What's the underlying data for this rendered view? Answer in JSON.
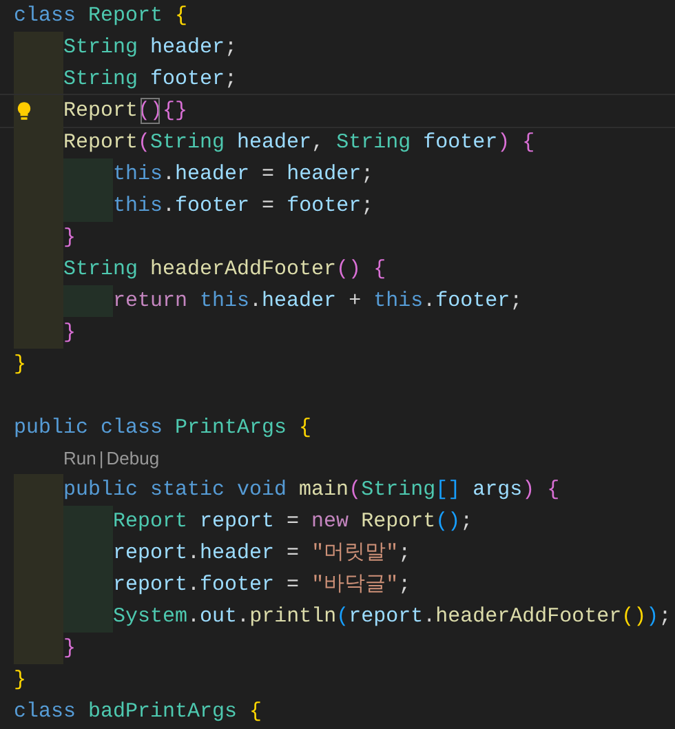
{
  "editor": {
    "lines": [
      {
        "kind": "code",
        "current": false,
        "tokens": [
          {
            "kind": "keyword",
            "text": "class"
          },
          {
            "kind": "type",
            "text": " Report"
          },
          {
            "kind": "bracket1",
            "text": " {"
          }
        ],
        "children": [
          {
            "kind": "code",
            "current": false,
            "tokens": [
              {
                "kind": "type",
                "text": "String"
              },
              {
                "kind": "variable",
                "text": " header"
              },
              {
                "kind": "plain",
                "text": ";"
              }
            ]
          },
          {
            "kind": "code",
            "current": false,
            "tokens": [
              {
                "kind": "type",
                "text": "String"
              },
              {
                "kind": "variable",
                "text": " footer"
              },
              {
                "kind": "plain",
                "text": ";"
              }
            ]
          },
          {
            "kind": "code",
            "current": true,
            "tokens": [
              {
                "kind": "function",
                "text": "Report"
              },
              {
                "kind": "match",
                "text": "()"
              },
              {
                "kind": "bracket2",
                "text": "{}"
              }
            ]
          },
          {
            "kind": "code",
            "current": false,
            "tokens": [
              {
                "kind": "function",
                "text": "Report"
              },
              {
                "kind": "bracket2",
                "text": "("
              },
              {
                "kind": "type",
                "text": "String"
              },
              {
                "kind": "variable",
                "text": " header"
              },
              {
                "kind": "plain",
                "text": ","
              },
              {
                "kind": "type",
                "text": " String"
              },
              {
                "kind": "variable",
                "text": " footer"
              },
              {
                "kind": "bracket2",
                "text": ")"
              },
              {
                "kind": "bracket2",
                "text": " {"
              }
            ],
            "children": [
              {
                "kind": "code",
                "current": false,
                "tokens": [
                  {
                    "kind": "keyword",
                    "text": "this"
                  },
                  {
                    "kind": "plain",
                    "text": "."
                  },
                  {
                    "kind": "variable",
                    "text": "header"
                  },
                  {
                    "kind": "plain",
                    "text": " ="
                  },
                  {
                    "kind": "variable",
                    "text": " header"
                  },
                  {
                    "kind": "plain",
                    "text": ";"
                  }
                ]
              },
              {
                "kind": "code",
                "current": false,
                "tokens": [
                  {
                    "kind": "keyword",
                    "text": "this"
                  },
                  {
                    "kind": "plain",
                    "text": "."
                  },
                  {
                    "kind": "variable",
                    "text": "footer"
                  },
                  {
                    "kind": "plain",
                    "text": " ="
                  },
                  {
                    "kind": "variable",
                    "text": " footer"
                  },
                  {
                    "kind": "plain",
                    "text": ";"
                  }
                ]
              }
            ]
          },
          {
            "kind": "code",
            "current": false,
            "tokens": [
              {
                "kind": "bracket2",
                "text": "}"
              }
            ]
          },
          {
            "kind": "code",
            "current": false,
            "tokens": [
              {
                "kind": "type",
                "text": "String"
              },
              {
                "kind": "function",
                "text": " headerAddFooter"
              },
              {
                "kind": "bracket2",
                "text": "()"
              },
              {
                "kind": "bracket2",
                "text": " {"
              }
            ],
            "children": [
              {
                "kind": "code",
                "current": false,
                "tokens": [
                  {
                    "kind": "control",
                    "text": "return"
                  },
                  {
                    "kind": "keyword",
                    "text": " this"
                  },
                  {
                    "kind": "plain",
                    "text": "."
                  },
                  {
                    "kind": "variable",
                    "text": "header"
                  },
                  {
                    "kind": "plain",
                    "text": " +"
                  },
                  {
                    "kind": "keyword",
                    "text": " this"
                  },
                  {
                    "kind": "plain",
                    "text": "."
                  },
                  {
                    "kind": "variable",
                    "text": "footer"
                  },
                  {
                    "kind": "plain",
                    "text": ";"
                  }
                ]
              }
            ]
          },
          {
            "kind": "code",
            "current": false,
            "tokens": [
              {
                "kind": "bracket2",
                "text": "}"
              }
            ]
          }
        ]
      },
      {
        "kind": "code",
        "current": false,
        "tokens": [
          {
            "kind": "bracket1",
            "text": "}"
          }
        ]
      },
      {
        "kind": "code",
        "current": false
      },
      {
        "kind": "code",
        "current": false,
        "tokens": [
          {
            "kind": "keyword",
            "text": "public"
          },
          {
            "kind": "keyword",
            "text": " class"
          },
          {
            "kind": "type",
            "text": " PrintArgs"
          },
          {
            "kind": "bracket1",
            "text": " {"
          }
        ],
        "children": [
          {
            "kind": "codelens",
            "current": false,
            "tokens": [
              {
                "kind": "link",
                "text": "Run"
              },
              {
                "kind": "separator",
                "text": "|"
              },
              {
                "kind": "link",
                "text": "Debug"
              }
            ]
          },
          {
            "kind": "code",
            "current": false,
            "tokens": [
              {
                "kind": "keyword",
                "text": "public"
              },
              {
                "kind": "keyword",
                "text": " static"
              },
              {
                "kind": "keyword",
                "text": " void"
              },
              {
                "kind": "function",
                "text": " main"
              },
              {
                "kind": "bracket2",
                "text": "("
              },
              {
                "kind": "type",
                "text": "String"
              },
              {
                "kind": "bracket3",
                "text": "[]"
              },
              {
                "kind": "variable",
                "text": " args"
              },
              {
                "kind": "bracket2",
                "text": ")"
              },
              {
                "kind": "bracket2",
                "text": " {"
              }
            ],
            "children": [
              {
                "kind": "code",
                "current": false,
                "tokens": [
                  {
                    "kind": "type",
                    "text": "Report"
                  },
                  {
                    "kind": "variable",
                    "text": " report"
                  },
                  {
                    "kind": "plain",
                    "text": " ="
                  },
                  {
                    "kind": "control",
                    "text": " new"
                  },
                  {
                    "kind": "function",
                    "text": " Report"
                  },
                  {
                    "kind": "bracket3",
                    "text": "()"
                  },
                  {
                    "kind": "plain",
                    "text": ";"
                  }
                ]
              },
              {
                "kind": "code",
                "current": false,
                "tokens": [
                  {
                    "kind": "variable",
                    "text": "report"
                  },
                  {
                    "kind": "plain",
                    "text": "."
                  },
                  {
                    "kind": "variable",
                    "text": "header"
                  },
                  {
                    "kind": "plain",
                    "text": " ="
                  },
                  {
                    "kind": "string",
                    "text": " \"머릿말\""
                  },
                  {
                    "kind": "plain",
                    "text": ";"
                  }
                ]
              },
              {
                "kind": "code",
                "current": false,
                "tokens": [
                  {
                    "kind": "variable",
                    "text": "report"
                  },
                  {
                    "kind": "plain",
                    "text": "."
                  },
                  {
                    "kind": "variable",
                    "text": "footer"
                  },
                  {
                    "kind": "plain",
                    "text": " ="
                  },
                  {
                    "kind": "string",
                    "text": " \"바닥글\""
                  },
                  {
                    "kind": "plain",
                    "text": ";"
                  }
                ]
              },
              {
                "kind": "code",
                "current": false,
                "tokens": [
                  {
                    "kind": "type",
                    "text": "System"
                  },
                  {
                    "kind": "plain",
                    "text": "."
                  },
                  {
                    "kind": "variable",
                    "text": "out"
                  },
                  {
                    "kind": "plain",
                    "text": "."
                  },
                  {
                    "kind": "function",
                    "text": "println"
                  },
                  {
                    "kind": "bracket3",
                    "text": "("
                  },
                  {
                    "kind": "variable",
                    "text": "report"
                  },
                  {
                    "kind": "plain",
                    "text": "."
                  },
                  {
                    "kind": "function",
                    "text": "headerAddFooter"
                  },
                  {
                    "kind": "bracket1",
                    "text": "()"
                  },
                  {
                    "kind": "bracket3",
                    "text": ")"
                  },
                  {
                    "kind": "plain",
                    "text": ";"
                  }
                ]
              }
            ]
          },
          {
            "kind": "code",
            "current": false,
            "tokens": [
              {
                "kind": "bracket2",
                "text": "}"
              }
            ]
          }
        ]
      },
      {
        "kind": "code",
        "current": false,
        "tokens": [
          {
            "kind": "bracket1",
            "text": "}"
          }
        ]
      },
      {
        "kind": "code",
        "current": false,
        "tokens": [
          {
            "kind": "keyword",
            "text": "class"
          },
          {
            "kind": "type",
            "text": " badPrintArgs"
          },
          {
            "kind": "bracket1",
            "text": " {"
          }
        ]
      }
    ]
  }
}
